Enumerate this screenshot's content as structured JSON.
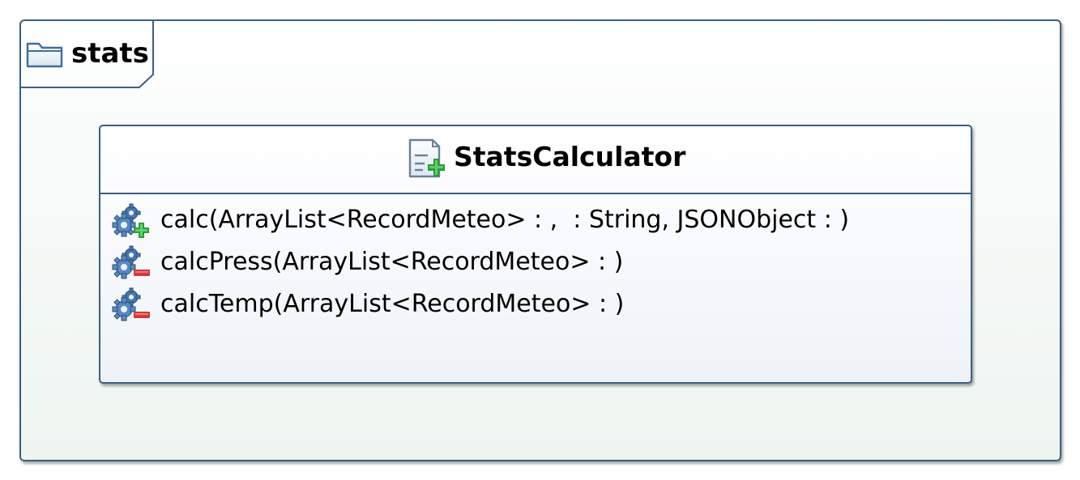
{
  "package": {
    "name": "stats",
    "icon": "folder-icon"
  },
  "class": {
    "name": "StatsCalculator",
    "icon": "class-add-icon",
    "operations": [
      {
        "label": "calc(ArrayList<RecordMeteo> : ,  : String, JSONObject : )",
        "visibility": "public",
        "icon": "gear-plus-icon"
      },
      {
        "label": "calcPress(ArrayList<RecordMeteo> : )",
        "visibility": "private",
        "icon": "gear-minus-icon"
      },
      {
        "label": "calcTemp(ArrayList<RecordMeteo> : )",
        "visibility": "private",
        "icon": "gear-minus-icon"
      }
    ]
  },
  "colors": {
    "border": "#3d5f82",
    "public_badge": "#2e9b3a",
    "private_badge": "#d23a3a",
    "gear": "#4a78b0"
  }
}
